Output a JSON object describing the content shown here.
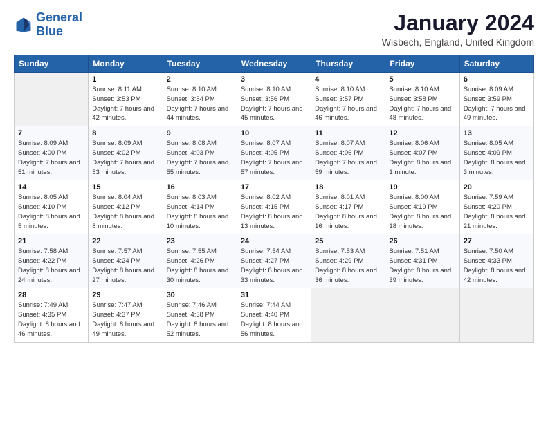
{
  "logo": {
    "line1": "General",
    "line2": "Blue"
  },
  "header": {
    "title": "January 2024",
    "location": "Wisbech, England, United Kingdom"
  },
  "days_of_week": [
    "Sunday",
    "Monday",
    "Tuesday",
    "Wednesday",
    "Thursday",
    "Friday",
    "Saturday"
  ],
  "weeks": [
    [
      {
        "day": "",
        "sunrise": "",
        "sunset": "",
        "daylight": ""
      },
      {
        "day": "1",
        "sunrise": "8:11 AM",
        "sunset": "3:53 PM",
        "daylight": "7 hours and 42 minutes."
      },
      {
        "day": "2",
        "sunrise": "8:10 AM",
        "sunset": "3:54 PM",
        "daylight": "7 hours and 44 minutes."
      },
      {
        "day": "3",
        "sunrise": "8:10 AM",
        "sunset": "3:56 PM",
        "daylight": "7 hours and 45 minutes."
      },
      {
        "day": "4",
        "sunrise": "8:10 AM",
        "sunset": "3:57 PM",
        "daylight": "7 hours and 46 minutes."
      },
      {
        "day": "5",
        "sunrise": "8:10 AM",
        "sunset": "3:58 PM",
        "daylight": "7 hours and 48 minutes."
      },
      {
        "day": "6",
        "sunrise": "8:09 AM",
        "sunset": "3:59 PM",
        "daylight": "7 hours and 49 minutes."
      }
    ],
    [
      {
        "day": "7",
        "sunrise": "8:09 AM",
        "sunset": "4:00 PM",
        "daylight": "7 hours and 51 minutes."
      },
      {
        "day": "8",
        "sunrise": "8:09 AM",
        "sunset": "4:02 PM",
        "daylight": "7 hours and 53 minutes."
      },
      {
        "day": "9",
        "sunrise": "8:08 AM",
        "sunset": "4:03 PM",
        "daylight": "7 hours and 55 minutes."
      },
      {
        "day": "10",
        "sunrise": "8:07 AM",
        "sunset": "4:05 PM",
        "daylight": "7 hours and 57 minutes."
      },
      {
        "day": "11",
        "sunrise": "8:07 AM",
        "sunset": "4:06 PM",
        "daylight": "7 hours and 59 minutes."
      },
      {
        "day": "12",
        "sunrise": "8:06 AM",
        "sunset": "4:07 PM",
        "daylight": "8 hours and 1 minute."
      },
      {
        "day": "13",
        "sunrise": "8:05 AM",
        "sunset": "4:09 PM",
        "daylight": "8 hours and 3 minutes."
      }
    ],
    [
      {
        "day": "14",
        "sunrise": "8:05 AM",
        "sunset": "4:10 PM",
        "daylight": "8 hours and 5 minutes."
      },
      {
        "day": "15",
        "sunrise": "8:04 AM",
        "sunset": "4:12 PM",
        "daylight": "8 hours and 8 minutes."
      },
      {
        "day": "16",
        "sunrise": "8:03 AM",
        "sunset": "4:14 PM",
        "daylight": "8 hours and 10 minutes."
      },
      {
        "day": "17",
        "sunrise": "8:02 AM",
        "sunset": "4:15 PM",
        "daylight": "8 hours and 13 minutes."
      },
      {
        "day": "18",
        "sunrise": "8:01 AM",
        "sunset": "4:17 PM",
        "daylight": "8 hours and 16 minutes."
      },
      {
        "day": "19",
        "sunrise": "8:00 AM",
        "sunset": "4:19 PM",
        "daylight": "8 hours and 18 minutes."
      },
      {
        "day": "20",
        "sunrise": "7:59 AM",
        "sunset": "4:20 PM",
        "daylight": "8 hours and 21 minutes."
      }
    ],
    [
      {
        "day": "21",
        "sunrise": "7:58 AM",
        "sunset": "4:22 PM",
        "daylight": "8 hours and 24 minutes."
      },
      {
        "day": "22",
        "sunrise": "7:57 AM",
        "sunset": "4:24 PM",
        "daylight": "8 hours and 27 minutes."
      },
      {
        "day": "23",
        "sunrise": "7:55 AM",
        "sunset": "4:26 PM",
        "daylight": "8 hours and 30 minutes."
      },
      {
        "day": "24",
        "sunrise": "7:54 AM",
        "sunset": "4:27 PM",
        "daylight": "8 hours and 33 minutes."
      },
      {
        "day": "25",
        "sunrise": "7:53 AM",
        "sunset": "4:29 PM",
        "daylight": "8 hours and 36 minutes."
      },
      {
        "day": "26",
        "sunrise": "7:51 AM",
        "sunset": "4:31 PM",
        "daylight": "8 hours and 39 minutes."
      },
      {
        "day": "27",
        "sunrise": "7:50 AM",
        "sunset": "4:33 PM",
        "daylight": "8 hours and 42 minutes."
      }
    ],
    [
      {
        "day": "28",
        "sunrise": "7:49 AM",
        "sunset": "4:35 PM",
        "daylight": "8 hours and 46 minutes."
      },
      {
        "day": "29",
        "sunrise": "7:47 AM",
        "sunset": "4:37 PM",
        "daylight": "8 hours and 49 minutes."
      },
      {
        "day": "30",
        "sunrise": "7:46 AM",
        "sunset": "4:38 PM",
        "daylight": "8 hours and 52 minutes."
      },
      {
        "day": "31",
        "sunrise": "7:44 AM",
        "sunset": "4:40 PM",
        "daylight": "8 hours and 56 minutes."
      },
      {
        "day": "",
        "sunrise": "",
        "sunset": "",
        "daylight": ""
      },
      {
        "day": "",
        "sunrise": "",
        "sunset": "",
        "daylight": ""
      },
      {
        "day": "",
        "sunrise": "",
        "sunset": "",
        "daylight": ""
      }
    ]
  ]
}
